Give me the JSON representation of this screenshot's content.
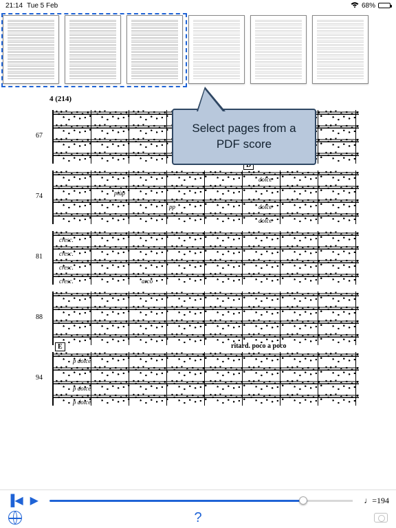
{
  "status": {
    "time": "21:14",
    "date": "Tue 5 Feb",
    "battery_pct": "68%"
  },
  "thumbs": {
    "selected_count": 3,
    "total": 6
  },
  "callout": {
    "text": "Select pages from a PDF score"
  },
  "score": {
    "page_header": "4 (214)",
    "systems": [
      {
        "measure": "67",
        "rehearsal": null,
        "directive": null,
        "dynamics": []
      },
      {
        "measure": "74",
        "rehearsal": "D",
        "directive": null,
        "dynamics": [
          "dolce",
          "piùp",
          "pp",
          "dolce",
          "dolce"
        ]
      },
      {
        "measure": "81",
        "rehearsal": null,
        "directive": null,
        "dynamics": [
          "cresc.",
          "cresc.",
          "cresc.",
          "cresc.",
          "arco"
        ]
      },
      {
        "measure": "88",
        "rehearsal": null,
        "directive": null,
        "dynamics": []
      },
      {
        "measure": "94",
        "rehearsal": "E",
        "directive": "ritard. poco a poco",
        "dynamics": [
          "p dolce",
          "p dolce",
          "p dolce"
        ]
      }
    ]
  },
  "playback": {
    "tempo_label": "♩=194"
  },
  "toolbar": {
    "help_label": "?"
  }
}
